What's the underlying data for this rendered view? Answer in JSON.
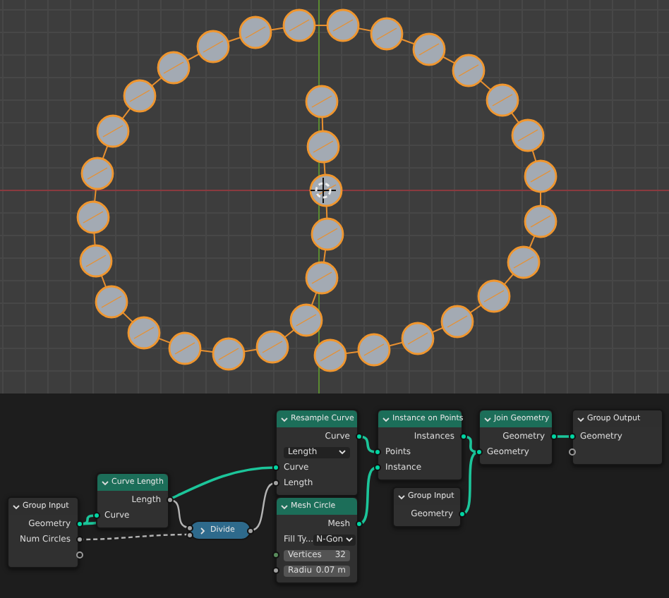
{
  "node_editor": {
    "nodes": [
      {
        "title": "Group Input",
        "kind": "group",
        "rows": [
          {
            "kind": "output",
            "label": "Geometry",
            "color": "#00d6a3"
          },
          {
            "kind": "output",
            "label": "Num Circles",
            "color": "#a1a1a1"
          },
          {
            "kind": "output"
          }
        ]
      },
      {
        "title": "Curve Length",
        "kind": "geometry",
        "rows": [
          {
            "kind": "output",
            "label": "Length",
            "color": "#a1a1a1"
          },
          {
            "kind": "input",
            "label": "Curve",
            "color": "#00d6a3"
          }
        ]
      },
      {
        "title": "Divide",
        "kind": "math"
      },
      {
        "title": "Resample Curve",
        "kind": "geometry",
        "rows": [
          {
            "kind": "output",
            "label": "Curve",
            "color": "#00d6a3"
          },
          {
            "kind": "dropdown",
            "value": "Length"
          },
          {
            "kind": "input",
            "label": "Curve",
            "color": "#00d6a3"
          },
          {
            "kind": "input",
            "label": "Length",
            "color": "#a1a1a1"
          }
        ]
      },
      {
        "title": "Mesh Circle",
        "kind": "geometry",
        "rows": [
          {
            "kind": "output",
            "label": "Mesh",
            "color": "#00d6a3"
          },
          {
            "kind": "select",
            "label": "Fill Ty...",
            "value": "N-Gon"
          },
          {
            "kind": "field",
            "label": "Vertices",
            "value": "32",
            "color": "#598c5c"
          },
          {
            "kind": "field",
            "label": "Radiu",
            "value": "0.07 m",
            "color": "#a1a1a1"
          }
        ]
      },
      {
        "title": "Instance on Points",
        "kind": "geometry",
        "rows": [
          {
            "kind": "output",
            "label": "Instances",
            "color": "#00d6a3"
          },
          {
            "kind": "input",
            "label": "Points",
            "color": "#00d6a3"
          },
          {
            "kind": "input",
            "label": "Instance",
            "color": "#00d6a3"
          }
        ]
      },
      {
        "title": "Group Input",
        "kind": "group",
        "rows": [
          {
            "kind": "output",
            "label": "Geometry",
            "color": "#00d6a3"
          }
        ]
      },
      {
        "title": "Join Geometry",
        "kind": "geometry",
        "rows": [
          {
            "kind": "output",
            "label": "Geometry",
            "color": "#00d6a3"
          },
          {
            "kind": "input",
            "label": "Geometry",
            "color": "#00d6a3"
          }
        ]
      },
      {
        "title": "Group Output",
        "kind": "group",
        "rows": [
          {
            "kind": "input",
            "label": "Geometry",
            "color": "#00d6a3"
          },
          {
            "kind": "input"
          }
        ]
      }
    ]
  }
}
